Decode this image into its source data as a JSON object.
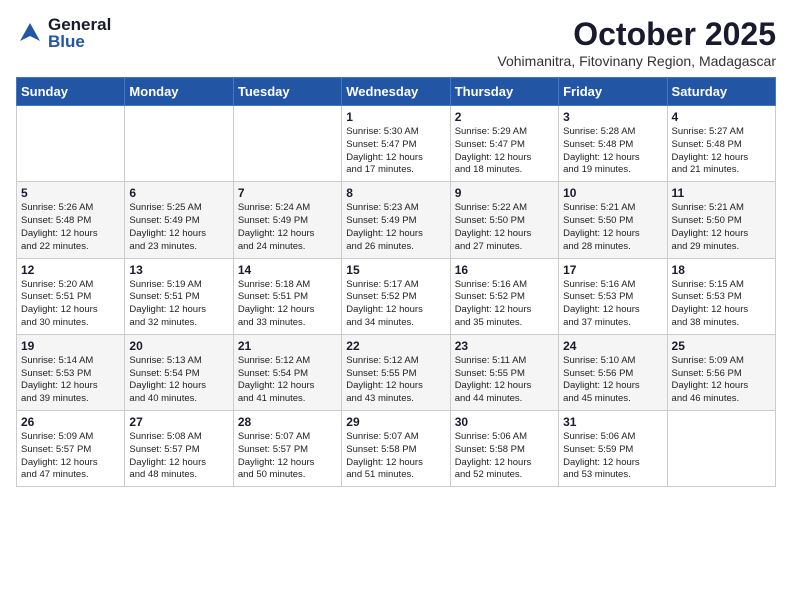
{
  "header": {
    "logo_general": "General",
    "logo_blue": "Blue",
    "month": "October 2025",
    "location": "Vohimanitra, Fitovinany Region, Madagascar"
  },
  "weekdays": [
    "Sunday",
    "Monday",
    "Tuesday",
    "Wednesday",
    "Thursday",
    "Friday",
    "Saturday"
  ],
  "weeks": [
    [
      {
        "day": "",
        "info": ""
      },
      {
        "day": "",
        "info": ""
      },
      {
        "day": "",
        "info": ""
      },
      {
        "day": "1",
        "info": "Sunrise: 5:30 AM\nSunset: 5:47 PM\nDaylight: 12 hours\nand 17 minutes."
      },
      {
        "day": "2",
        "info": "Sunrise: 5:29 AM\nSunset: 5:47 PM\nDaylight: 12 hours\nand 18 minutes."
      },
      {
        "day": "3",
        "info": "Sunrise: 5:28 AM\nSunset: 5:48 PM\nDaylight: 12 hours\nand 19 minutes."
      },
      {
        "day": "4",
        "info": "Sunrise: 5:27 AM\nSunset: 5:48 PM\nDaylight: 12 hours\nand 21 minutes."
      }
    ],
    [
      {
        "day": "5",
        "info": "Sunrise: 5:26 AM\nSunset: 5:48 PM\nDaylight: 12 hours\nand 22 minutes."
      },
      {
        "day": "6",
        "info": "Sunrise: 5:25 AM\nSunset: 5:49 PM\nDaylight: 12 hours\nand 23 minutes."
      },
      {
        "day": "7",
        "info": "Sunrise: 5:24 AM\nSunset: 5:49 PM\nDaylight: 12 hours\nand 24 minutes."
      },
      {
        "day": "8",
        "info": "Sunrise: 5:23 AM\nSunset: 5:49 PM\nDaylight: 12 hours\nand 26 minutes."
      },
      {
        "day": "9",
        "info": "Sunrise: 5:22 AM\nSunset: 5:50 PM\nDaylight: 12 hours\nand 27 minutes."
      },
      {
        "day": "10",
        "info": "Sunrise: 5:21 AM\nSunset: 5:50 PM\nDaylight: 12 hours\nand 28 minutes."
      },
      {
        "day": "11",
        "info": "Sunrise: 5:21 AM\nSunset: 5:50 PM\nDaylight: 12 hours\nand 29 minutes."
      }
    ],
    [
      {
        "day": "12",
        "info": "Sunrise: 5:20 AM\nSunset: 5:51 PM\nDaylight: 12 hours\nand 30 minutes."
      },
      {
        "day": "13",
        "info": "Sunrise: 5:19 AM\nSunset: 5:51 PM\nDaylight: 12 hours\nand 32 minutes."
      },
      {
        "day": "14",
        "info": "Sunrise: 5:18 AM\nSunset: 5:51 PM\nDaylight: 12 hours\nand 33 minutes."
      },
      {
        "day": "15",
        "info": "Sunrise: 5:17 AM\nSunset: 5:52 PM\nDaylight: 12 hours\nand 34 minutes."
      },
      {
        "day": "16",
        "info": "Sunrise: 5:16 AM\nSunset: 5:52 PM\nDaylight: 12 hours\nand 35 minutes."
      },
      {
        "day": "17",
        "info": "Sunrise: 5:16 AM\nSunset: 5:53 PM\nDaylight: 12 hours\nand 37 minutes."
      },
      {
        "day": "18",
        "info": "Sunrise: 5:15 AM\nSunset: 5:53 PM\nDaylight: 12 hours\nand 38 minutes."
      }
    ],
    [
      {
        "day": "19",
        "info": "Sunrise: 5:14 AM\nSunset: 5:53 PM\nDaylight: 12 hours\nand 39 minutes."
      },
      {
        "day": "20",
        "info": "Sunrise: 5:13 AM\nSunset: 5:54 PM\nDaylight: 12 hours\nand 40 minutes."
      },
      {
        "day": "21",
        "info": "Sunrise: 5:12 AM\nSunset: 5:54 PM\nDaylight: 12 hours\nand 41 minutes."
      },
      {
        "day": "22",
        "info": "Sunrise: 5:12 AM\nSunset: 5:55 PM\nDaylight: 12 hours\nand 43 minutes."
      },
      {
        "day": "23",
        "info": "Sunrise: 5:11 AM\nSunset: 5:55 PM\nDaylight: 12 hours\nand 44 minutes."
      },
      {
        "day": "24",
        "info": "Sunrise: 5:10 AM\nSunset: 5:56 PM\nDaylight: 12 hours\nand 45 minutes."
      },
      {
        "day": "25",
        "info": "Sunrise: 5:09 AM\nSunset: 5:56 PM\nDaylight: 12 hours\nand 46 minutes."
      }
    ],
    [
      {
        "day": "26",
        "info": "Sunrise: 5:09 AM\nSunset: 5:57 PM\nDaylight: 12 hours\nand 47 minutes."
      },
      {
        "day": "27",
        "info": "Sunrise: 5:08 AM\nSunset: 5:57 PM\nDaylight: 12 hours\nand 48 minutes."
      },
      {
        "day": "28",
        "info": "Sunrise: 5:07 AM\nSunset: 5:57 PM\nDaylight: 12 hours\nand 50 minutes."
      },
      {
        "day": "29",
        "info": "Sunrise: 5:07 AM\nSunset: 5:58 PM\nDaylight: 12 hours\nand 51 minutes."
      },
      {
        "day": "30",
        "info": "Sunrise: 5:06 AM\nSunset: 5:58 PM\nDaylight: 12 hours\nand 52 minutes."
      },
      {
        "day": "31",
        "info": "Sunrise: 5:06 AM\nSunset: 5:59 PM\nDaylight: 12 hours\nand 53 minutes."
      },
      {
        "day": "",
        "info": ""
      }
    ]
  ]
}
